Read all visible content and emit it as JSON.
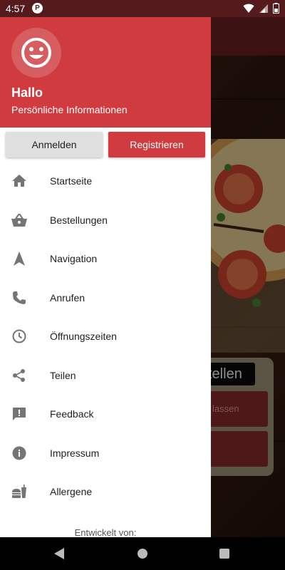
{
  "status_bar": {
    "time": "4:57",
    "app_icon_letter": "P"
  },
  "header": {
    "title": "Hallo",
    "subtitle": "Persönliche Informationen"
  },
  "auth": {
    "login_label": "Anmelden",
    "register_label": "Registrieren"
  },
  "menu": {
    "items": [
      {
        "label": "Startseite",
        "icon": "home-icon"
      },
      {
        "label": "Bestellungen",
        "icon": "basket-icon"
      },
      {
        "label": "Navigation",
        "icon": "navigation-icon"
      },
      {
        "label": "Anrufen",
        "icon": "phone-icon"
      },
      {
        "label": "Öffnungszeiten",
        "icon": "clock-icon"
      },
      {
        "label": "Teilen",
        "icon": "share-icon"
      },
      {
        "label": "Feedback",
        "icon": "feedback-icon"
      },
      {
        "label": "Impressum",
        "icon": "info-icon"
      },
      {
        "label": "Allergene",
        "icon": "food-icon"
      }
    ]
  },
  "footer": {
    "text": "Entwickelt von:"
  },
  "background": {
    "panel_title": "tellen",
    "panel_button": "lassen"
  },
  "colors": {
    "primary": "#cf3b3e",
    "primary_dark": "#541a1c",
    "icon": "#757575"
  }
}
